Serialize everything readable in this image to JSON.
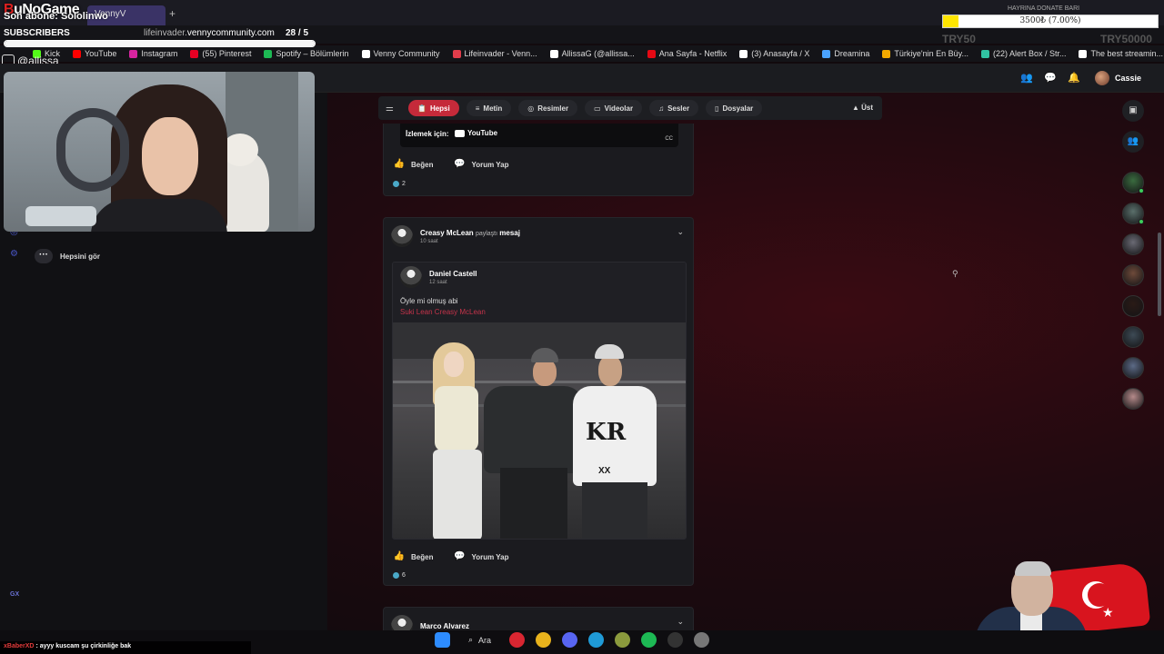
{
  "overlay": {
    "logo_prefix": "B",
    "logo_rest": "uNoGame",
    "last_sub": "Son abone: Sololinwo",
    "subs_label": "SUBSCRIBERS",
    "subs_count": "28 / 5",
    "subs_progress": 1.0,
    "handle": "@allissa",
    "donate_title": "HAYRINA DONATE BARI",
    "donate_text": "3500₺ (7.00%)",
    "donate_progress": 0.07,
    "donate_min": "TRY50",
    "donate_max": "TRY50000"
  },
  "browser": {
    "tab_title": "VennyV",
    "new_tab": "+",
    "url_prefix": "lifeinvader.",
    "url_domain": "vennycommunity.com",
    "bookmarks": [
      {
        "label": "Kick",
        "color": "#53fc18"
      },
      {
        "label": "YouTube",
        "color": "#ff0000"
      },
      {
        "label": "Instagram",
        "color": "#d6249f"
      },
      {
        "label": "(55) Pinterest",
        "color": "#e60023"
      },
      {
        "label": "Spotify – Bölümlerin",
        "color": "#1db954"
      },
      {
        "label": "Venny Community",
        "color": "#ffffff"
      },
      {
        "label": "Lifeinvader - Venn...",
        "color": "#e23d4b"
      },
      {
        "label": "AllissaG (@allissa...",
        "color": "#ffffff"
      },
      {
        "label": "Ana Sayfa - Netflix",
        "color": "#e50914"
      },
      {
        "label": "(3) Anasayfa / X",
        "color": "#ffffff"
      },
      {
        "label": "Dreamina",
        "color": "#4aa3ff"
      },
      {
        "label": "Türkiye'nin En Büy...",
        "color": "#f2a900"
      },
      {
        "label": "(22) Alert Box / Str...",
        "color": "#31c3a2"
      },
      {
        "label": "The best streamin...",
        "color": "#ffffff"
      }
    ]
  },
  "header": {
    "user_name": "Cassie"
  },
  "left": {
    "see_all": "Hepsini gör",
    "gx": "GX"
  },
  "filters": {
    "items": [
      {
        "label": "Hepsi",
        "icon": "📋",
        "active": true
      },
      {
        "label": "Metin",
        "icon": "≡",
        "active": false
      },
      {
        "label": "Resimler",
        "icon": "◎",
        "active": false
      },
      {
        "label": "Videolar",
        "icon": "▭",
        "active": false
      },
      {
        "label": "Sesler",
        "icon": "♫",
        "active": false
      },
      {
        "label": "Dosyalar",
        "icon": "▯",
        "active": false
      }
    ],
    "top": "▲ Üst"
  },
  "post1": {
    "watch_label": "İzlemek için:",
    "youtube": "YouTube",
    "cc": "CC",
    "like": "Beğen",
    "comment": "Yorum Yap",
    "reactions": "2"
  },
  "post2": {
    "author": "Creasy McLean",
    "action_prefix": "paylaştı",
    "action_word": "mesaj",
    "time": "10 saat",
    "inner_author": "Daniel Castell",
    "inner_time": "12 saat",
    "inner_text": "Öyle mi olmuş abi",
    "inner_tags": "Suki Lean Creasy McLean",
    "logo_text": "KR",
    "num_text": "XX",
    "like": "Beğen",
    "comment": "Yorum Yap",
    "reactions": "6"
  },
  "post3": {
    "author": "Marco Alvarez"
  },
  "rail": {
    "avatars": [
      "#3a6b3f",
      "#5a6f6b",
      "#6a6a74",
      "#6e4a3a",
      "#2a1a16",
      "#3d4a55",
      "#5c6a86",
      "#b58a8a"
    ]
  },
  "chat": {
    "user": "xBaberXD",
    "message": ": ayyy kuscam şu çirkinliğe bak"
  },
  "taskbar": {
    "search": "Ara"
  }
}
